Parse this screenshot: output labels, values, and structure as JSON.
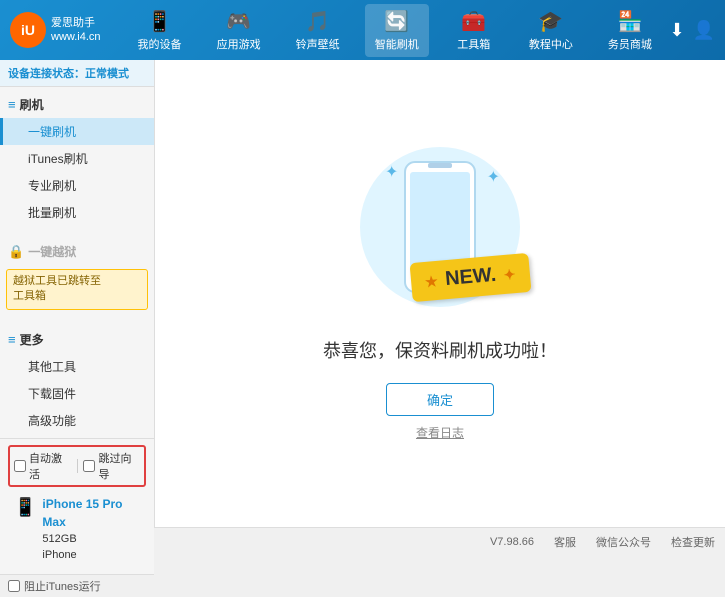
{
  "header": {
    "logo_short": "iU",
    "logo_line1": "爱思助手",
    "logo_line2": "www.i4.cn",
    "nav": [
      {
        "id": "my-device",
        "icon": "📱",
        "label": "我的设备"
      },
      {
        "id": "apps-games",
        "icon": "🎮",
        "label": "应用游戏"
      },
      {
        "id": "ringtones",
        "icon": "🎵",
        "label": "铃声壁纸"
      },
      {
        "id": "smart-brush",
        "icon": "🔄",
        "label": "智能刷机",
        "active": true
      },
      {
        "id": "toolbox",
        "icon": "🧰",
        "label": "工具箱"
      },
      {
        "id": "tutorials",
        "icon": "🎓",
        "label": "教程中心"
      },
      {
        "id": "business",
        "icon": "🏪",
        "label": "务员商城"
      }
    ]
  },
  "status_bar": {
    "prefix": "设备连接状态：",
    "status": "正常模式"
  },
  "sidebar": {
    "section_brush": "刷机",
    "items_brush": [
      {
        "id": "one-click-brush",
        "label": "一键刷机",
        "active": true
      },
      {
        "id": "itunes-brush",
        "label": "iTunes刷机"
      },
      {
        "id": "pro-brush",
        "label": "专业刷机"
      },
      {
        "id": "batch-brush",
        "label": "批量刷机"
      }
    ],
    "section_jailbreak": "一键越狱",
    "jailbreak_note_line1": "越狱工具已跳转至",
    "jailbreak_note_line2": "工具箱",
    "section_more": "更多",
    "items_more": [
      {
        "id": "other-tools",
        "label": "其他工具"
      },
      {
        "id": "download-firmware",
        "label": "下载固件"
      },
      {
        "id": "advanced",
        "label": "高级功能"
      }
    ],
    "checkbox_auto": "自动激活",
    "checkbox_guide": "跳过向导",
    "device_name": "iPhone 15 Pro Max",
    "device_storage": "512GB",
    "device_type": "iPhone",
    "stop_itunes": "阻止iTunes运行"
  },
  "content": {
    "success_title": "恭喜您，保资料刷机成功啦！",
    "btn_confirm": "确定",
    "btn_log": "查看日志",
    "new_badge": "NEW."
  },
  "footer": {
    "version": "V7.98.66",
    "items": [
      "客服",
      "微信公众号",
      "检查更新"
    ]
  }
}
